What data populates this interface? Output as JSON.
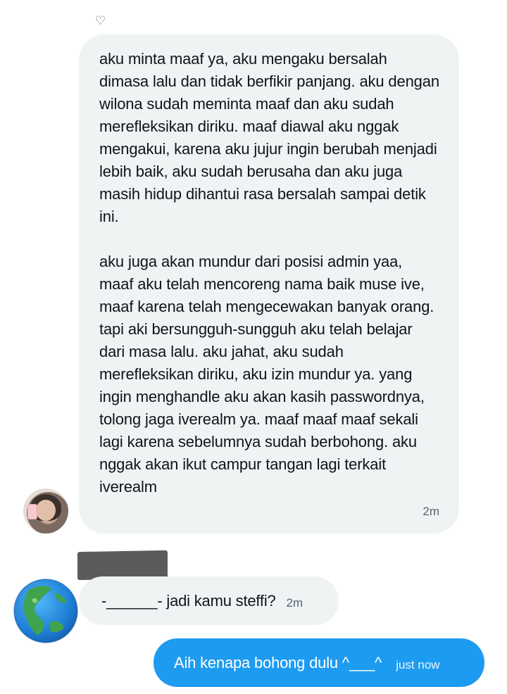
{
  "reaction_icon": "heart-outline-icon",
  "messages": [
    {
      "side": "left",
      "paragraphs": [
        "aku minta maaf ya, aku mengaku bersalah dimasa lalu dan tidak berfikir panjang. aku dengan wilona sudah meminta maaf dan aku sudah merefleksikan diriku. maaf diawal aku nggak mengakui, karena aku jujur ingin berubah menjadi lebih baik, aku sudah berusaha dan aku juga masih hidup dihantui rasa bersalah sampai detik ini.",
        "aku juga akan mundur dari posisi admin yaa, maaf aku telah mencoreng nama baik muse ive, maaf karena telah mengecewakan banyak orang. tapi aki bersungguh-sungguh aku telah belajar dari masa lalu. aku jahat, aku sudah merefleksikan diriku, aku izin mundur ya. yang ingin menghandle aku akan kasih passwordnya, tolong jaga iverealm ya. maaf maaf maaf sekali lagi karena sebelumnya sudah berbohong. aku nggak akan ikut campur tangan lagi terkait iverealm"
      ],
      "time": "2m"
    },
    {
      "side": "left",
      "text": "-______- jadi kamu steffi?",
      "time": "2m"
    },
    {
      "side": "right",
      "text": "Aih kenapa bohong dulu ^___^",
      "time": "just now"
    }
  ],
  "colors": {
    "incoming_bubble": "#eff3f4",
    "outgoing_bubble": "#1d9bf0",
    "timestamp": "#536471"
  }
}
